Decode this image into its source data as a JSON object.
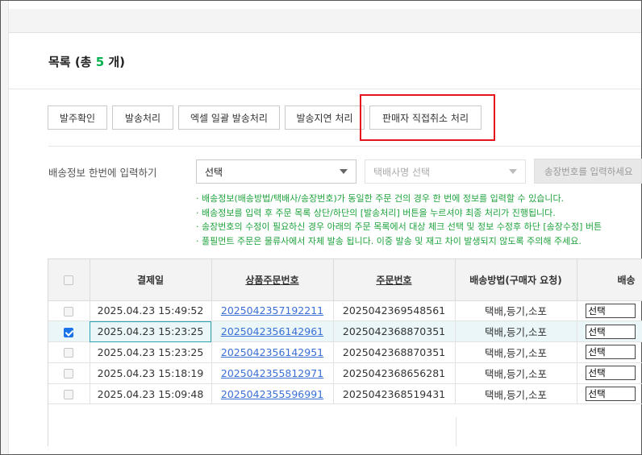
{
  "list": {
    "prefix": "목록 (총 ",
    "count": "5",
    "suffix": " 개)"
  },
  "buttons": [
    "발주확인",
    "발송처리",
    "엑셀 일괄 발송처리",
    "발송지연 처리",
    "판매자 직접취소 처리"
  ],
  "bulk": {
    "label": "배송정보 한번에 입력하기",
    "method_select": "선택",
    "courier_placeholder": "택배사명 선택",
    "invoice_placeholder": "송장번호를 입력하세요"
  },
  "notes": [
    "· 배송정보(배송방법/택배사/송장번호)가 동일한 주문 건의 경우 한 번에 정보를 입력할 수 있습니다.",
    "· 배송정보를 입력 후 주문 목록 상단/하단의 [발송처리] 버튼을 누르셔야 최종 처리가 진행됩니다.",
    "· 송장번호의 수정이 필요하신 경우 아래의 주문 목록에서 대상 체크 선택 및 정보 수정후 하단 [송장수정] 버튼",
    "· 풀필먼트 주문은 물류사에서 자체 발송 됩니다. 이중 발송 및 재고 차이 발생되지 않도록 주의해 주세요."
  ],
  "table": {
    "headers": [
      "결제일",
      "상품주문번호",
      "주문번호",
      "배송방법(구매자 요청)",
      "배송"
    ],
    "rows": [
      {
        "checked": false,
        "date": "2025.04.23 15:49:52",
        "product_order": "2025042357192211",
        "order": "2025042369548561",
        "method": "택배,등기,소포",
        "select": "선택"
      },
      {
        "checked": true,
        "date": "2025.04.23 15:23:25",
        "product_order": "2025042356142961",
        "order": "2025042368870351",
        "method": "택배,등기,소포",
        "select": "선택"
      },
      {
        "checked": false,
        "date": "2025.04.23 15:23:25",
        "product_order": "2025042356142951",
        "order": "2025042368870351",
        "method": "택배,등기,소포",
        "select": "선택"
      },
      {
        "checked": false,
        "date": "2025.04.23 15:18:19",
        "product_order": "2025042355812971",
        "order": "2025042368656281",
        "method": "택배,등기,소포",
        "select": "선택"
      },
      {
        "checked": false,
        "date": "2025.04.23 15:09:48",
        "product_order": "2025042355596991",
        "order": "2025042368519431",
        "method": "택배,등기,소포",
        "select": "선택"
      }
    ]
  },
  "colors": {
    "accent_green": "#00b24f",
    "note_green": "#1ea33c",
    "link_blue": "#3a6fd6",
    "highlight_red": "#e8141b",
    "checkbox_blue": "#1a73e8"
  }
}
